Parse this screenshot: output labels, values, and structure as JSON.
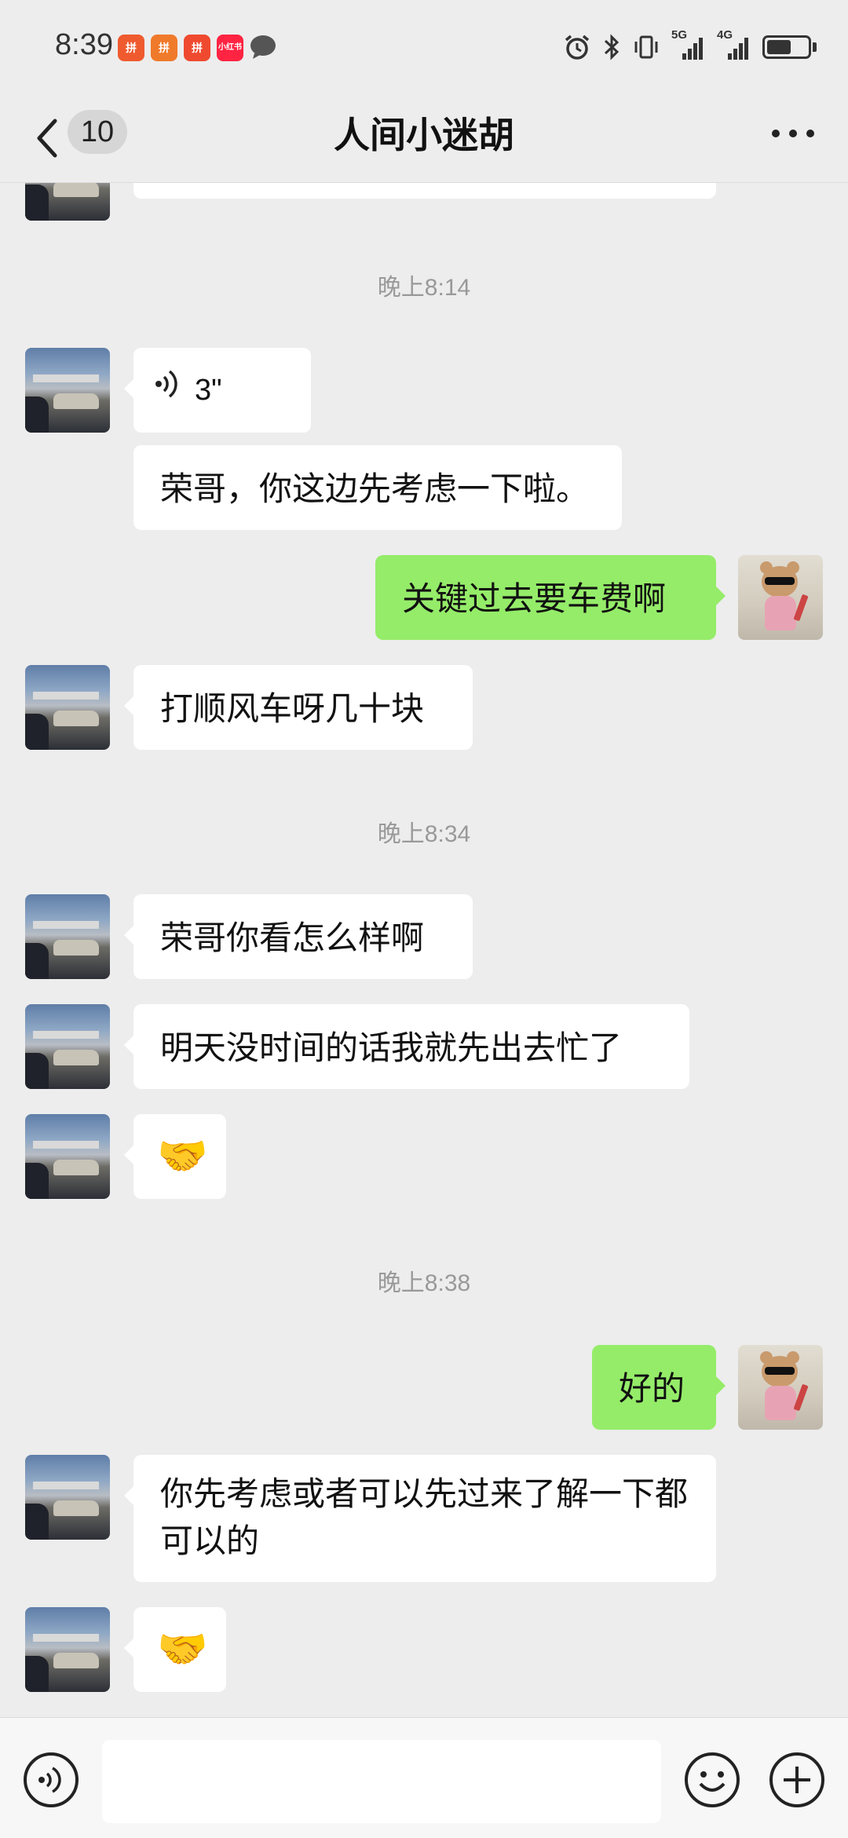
{
  "status_bar": {
    "time": "8:39",
    "badges": [
      "拼",
      "拼",
      "拼",
      "小红书"
    ],
    "network_1": "5G",
    "network_2": "4G",
    "battery_level": 0.6
  },
  "header": {
    "back_icon": "chevron-left-icon",
    "unread_count": "10",
    "title": "人间小迷胡",
    "more_icon": "more-dots-icon"
  },
  "messages": {
    "ts1": "晚上8:14",
    "voice_duration": "3\"",
    "m1": "荣哥，你这边先考虑一下啦。",
    "m2": "关键过去要车费啊",
    "m3": "打顺风车呀几十块",
    "ts2": "晚上8:34",
    "m4": "荣哥你看怎么样啊",
    "m5": "明天没时间的话我就先出去忙了",
    "m6": "🤝",
    "ts3": "晚上8:38",
    "m7": "好的",
    "m8": "你先考虑或者可以先过来了解一下都可以的",
    "m9": "🤝"
  },
  "input_bar": {
    "voice_icon": "voice-icon",
    "text_value": "",
    "emoji_icon": "emoji-icon",
    "plus_icon": "plus-icon"
  },
  "colors": {
    "background": "#ededed",
    "sent_bubble": "#95ec69",
    "received_bubble": "#ffffff",
    "timestamp": "#999999"
  }
}
